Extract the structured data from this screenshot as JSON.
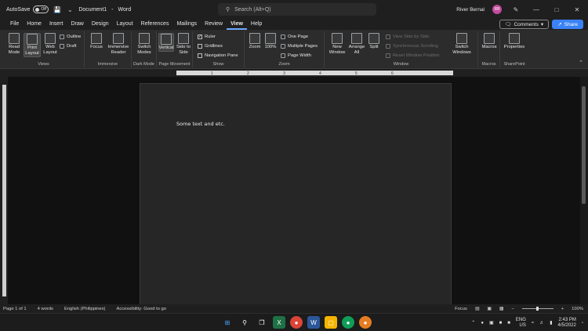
{
  "titlebar": {
    "autosave_label": "AutoSave",
    "autosave_state": "Off",
    "doc_title": "Document1",
    "app_name": "Word",
    "search_placeholder": "Search (Alt+Q)",
    "user_name": "River Bernal",
    "user_initials": "RB"
  },
  "menu": {
    "tabs": [
      "File",
      "Home",
      "Insert",
      "Draw",
      "Design",
      "Layout",
      "References",
      "Mailings",
      "Review",
      "View",
      "Help"
    ],
    "active": "View",
    "comments_label": "Comments",
    "share_label": "Share"
  },
  "ribbon": {
    "views": {
      "label": "Views",
      "read_mode": "Read Mode",
      "print_layout": "Print Layout",
      "web_layout": "Web Layout",
      "outline": "Outline",
      "draft": "Draft"
    },
    "immersive": {
      "label": "Immersive",
      "focus": "Focus",
      "reader": "Immersive Reader"
    },
    "dark_mode": {
      "label": "Dark Mode",
      "switch": "Switch Modes"
    },
    "page_movement": {
      "label": "Page Movement",
      "vertical": "Vertical",
      "side": "Side to Side"
    },
    "show": {
      "label": "Show",
      "ruler": "Ruler",
      "gridlines": "Gridlines",
      "nav_pane": "Navigation Pane"
    },
    "zoom": {
      "label": "Zoom",
      "zoom": "Zoom",
      "hundred": "100%",
      "one_page": "One Page",
      "multiple": "Multiple Pages",
      "page_width": "Page Width"
    },
    "window": {
      "label": "Window",
      "new_window": "New Window",
      "arrange_all": "Arrange All",
      "split": "Split",
      "side_by_side": "View Side by Side",
      "sync_scroll": "Synchronous Scrolling",
      "reset": "Reset Window Position",
      "switch": "Switch Windows"
    },
    "macros": {
      "label": "Macros",
      "macros": "Macros"
    },
    "sharepoint": {
      "label": "SharePoint",
      "properties": "Properties"
    }
  },
  "ruler": {
    "numbers": [
      "1",
      "2",
      "3",
      "4",
      "5",
      "6"
    ]
  },
  "document": {
    "text": "Some text and etc."
  },
  "status": {
    "page": "Page 1 of 1",
    "words": "4 words",
    "language": "English (Philippines)",
    "accessibility": "Accessibility: Good to go",
    "focus": "Focus",
    "zoom": "100%"
  },
  "taskbar": {
    "lang": "ENG",
    "region": "US",
    "time": "2:43 PM",
    "date": "4/5/2022"
  }
}
